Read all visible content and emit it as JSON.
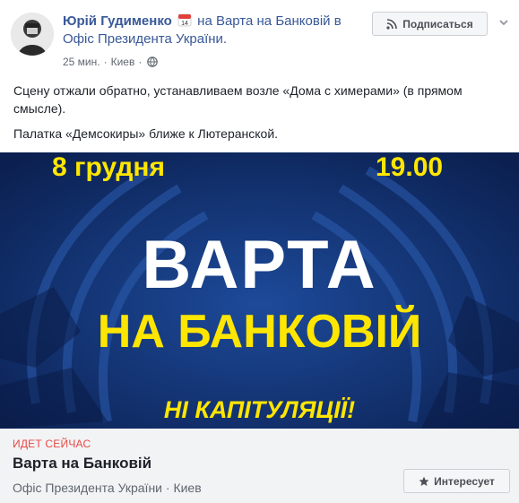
{
  "post": {
    "author": "Юрій Гудименко",
    "calendar_day": "14",
    "action_text": "на Варта на Банковій в Офіс Президента України.",
    "time": "25 мин.",
    "location": "Киев",
    "dot": "·",
    "subscribe_label": "Подписаться",
    "text1": "Сцену отжали обратно, устанавливаем возле «Дома с химерами» (в прямом смысле).",
    "text2": "Палатка «Демсокиры» ближе к Лютеранской."
  },
  "banner": {
    "date": "8 грудня",
    "time": "19.00",
    "title_line1": "ВАРТА",
    "title_line2": "НА БАНКОВІЙ",
    "slogan": "НІ КАПІТУЛЯЦІЇ!",
    "colors": {
      "background": "#102a5e",
      "title": "#ffffff",
      "accent": "#ffe600"
    }
  },
  "event": {
    "status": "ИДЕТ СЕЙЧАС",
    "title": "Варта на Банковій",
    "place": "Офіс Президента України",
    "dot": "·",
    "city": "Киев",
    "interest_label": "Интересует"
  }
}
